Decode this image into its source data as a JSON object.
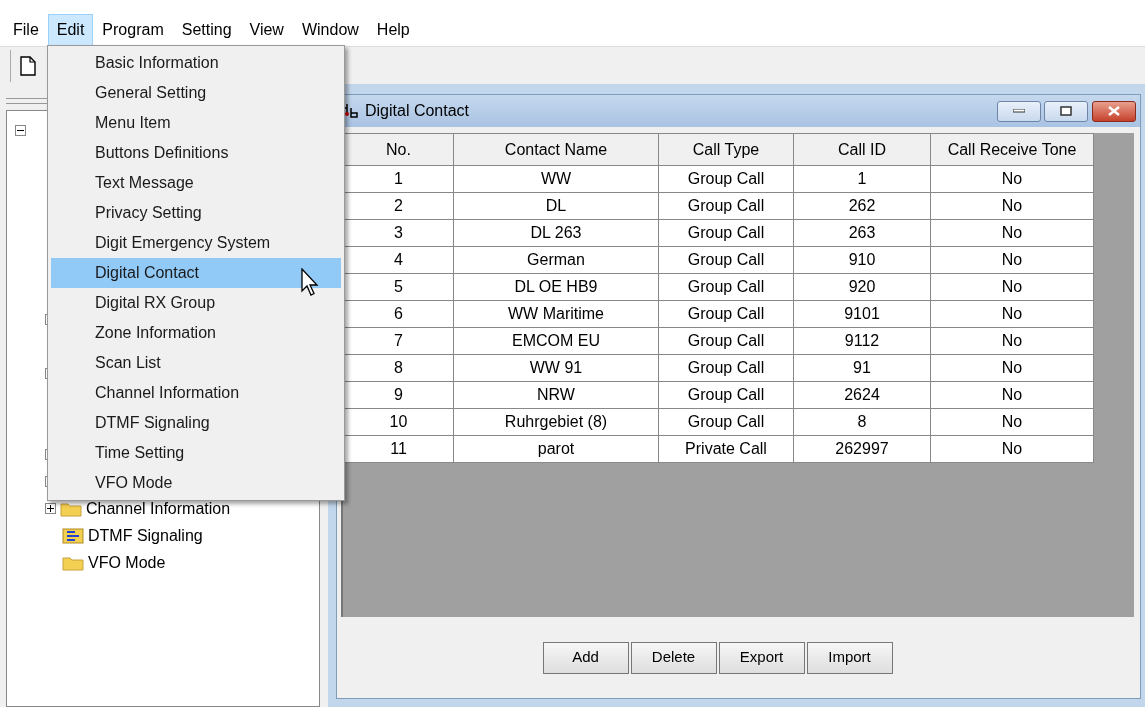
{
  "menu_bar": [
    {
      "label": "File",
      "selected": false
    },
    {
      "label": "Edit",
      "selected": true
    },
    {
      "label": "Program",
      "selected": false
    },
    {
      "label": "Setting",
      "selected": false
    },
    {
      "label": "View",
      "selected": false
    },
    {
      "label": "Window",
      "selected": false
    },
    {
      "label": "Help",
      "selected": false
    }
  ],
  "edit_menu": [
    {
      "label": "Basic Information",
      "selected": false
    },
    {
      "label": "General Setting",
      "selected": false
    },
    {
      "label": "Menu Item",
      "selected": false
    },
    {
      "label": "Buttons Definitions",
      "selected": false
    },
    {
      "label": "Text Message",
      "selected": false
    },
    {
      "label": "Privacy Setting",
      "selected": false
    },
    {
      "label": "Digit Emergency System",
      "selected": false
    },
    {
      "label": "Digital Contact",
      "selected": true
    },
    {
      "label": "Digital RX Group",
      "selected": false
    },
    {
      "label": "Zone Information",
      "selected": false
    },
    {
      "label": "Scan List",
      "selected": false
    },
    {
      "label": "Channel Information",
      "selected": false
    },
    {
      "label": "DTMF Signaling",
      "selected": false
    },
    {
      "label": "Time Setting",
      "selected": false
    },
    {
      "label": "VFO Mode",
      "selected": false
    }
  ],
  "tree": {
    "expanded": true,
    "children": [
      {
        "kind": "expander"
      },
      {
        "kind": "expander"
      },
      {
        "kind": "expander"
      },
      {
        "kind": "expander"
      },
      {
        "kind": "folder",
        "label": "Channel Information",
        "expanded": false
      },
      {
        "kind": "dtmf",
        "label": "DTMF Signaling"
      },
      {
        "kind": "folder",
        "label": "VFO Mode"
      }
    ]
  },
  "window": {
    "title": "Digital Contact"
  },
  "table": {
    "columns": [
      "No.",
      "Contact Name",
      "Call Type",
      "Call ID",
      "Call Receive Tone"
    ],
    "rows": [
      [
        "1",
        "WW",
        "Group Call",
        "1",
        "No"
      ],
      [
        "2",
        "DL",
        "Group Call",
        "262",
        "No"
      ],
      [
        "3",
        "DL 263",
        "Group Call",
        "263",
        "No"
      ],
      [
        "4",
        "German",
        "Group Call",
        "910",
        "No"
      ],
      [
        "5",
        "DL OE HB9",
        "Group Call",
        "920",
        "No"
      ],
      [
        "6",
        "WW Maritime",
        "Group Call",
        "9101",
        "No"
      ],
      [
        "7",
        "EMCOM EU",
        "Group Call",
        "9112",
        "No"
      ],
      [
        "8",
        "WW 91",
        "Group Call",
        "91",
        "No"
      ],
      [
        "9",
        "NRW",
        "Group Call",
        "2624",
        "No"
      ],
      [
        "10",
        "Ruhrgebiet (8)",
        "Group Call",
        "8",
        "No"
      ],
      [
        "11",
        "parot",
        "Private Call",
        "262997",
        "No"
      ]
    ]
  },
  "buttons": [
    "Add",
    "Delete",
    "Export",
    "Import"
  ]
}
